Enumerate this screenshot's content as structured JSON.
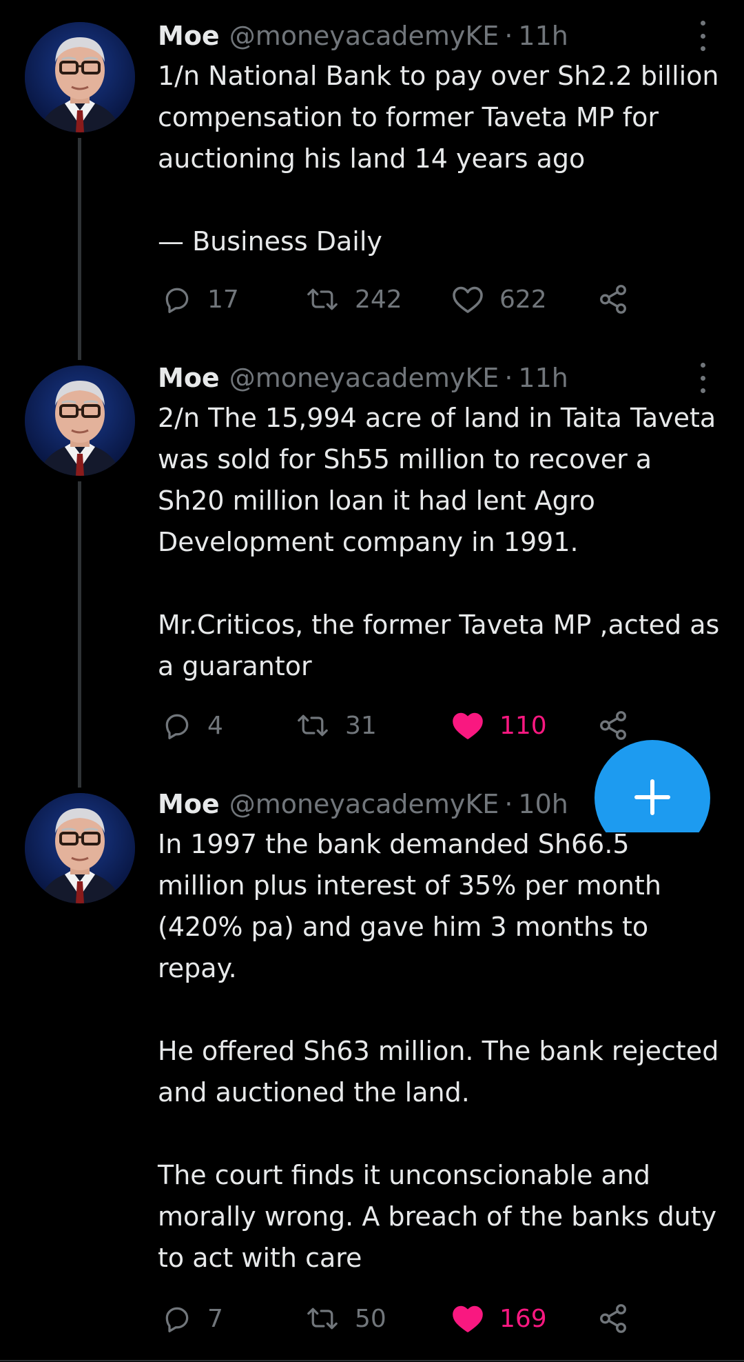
{
  "colors": {
    "background": "#000000",
    "text_primary": "#e7e9ea",
    "text_secondary": "#71767b",
    "like_active": "#f91880",
    "accent_blue": "#1d9bf0",
    "thread_line": "#2f3336"
  },
  "tweets": [
    {
      "author_name": "Moe",
      "handle": "@moneyacademyKE",
      "separator": "·",
      "time": "11h",
      "paragraphs": [
        "1/n National Bank to pay over Sh2.2 billion compensation to former Taveta MP for auctioning his land 14 years ago",
        "— Business Daily"
      ],
      "replies": "17",
      "retweets": "242",
      "likes": "622",
      "liked": false
    },
    {
      "author_name": "Moe",
      "handle": "@moneyacademyKE",
      "separator": "·",
      "time": "11h",
      "paragraphs": [
        "2/n The 15,994 acre of land in Taita Taveta was sold for Sh55 million to recover a Sh20 million loan it had lent Agro Development company in 1991.",
        "Mr.Criticos, the former Taveta MP ,acted as a guarantor"
      ],
      "replies": "4",
      "retweets": "31",
      "likes": "110",
      "liked": true
    },
    {
      "author_name": "Moe",
      "handle": "@moneyacademyKE",
      "separator": "·",
      "time": "10h",
      "paragraphs": [
        "In 1997 the bank demanded Sh66.5 million plus interest of 35% per month (420% pa) and gave him 3 months to repay.",
        "He offered Sh63 million. The bank rejected and auctioned the land.",
        "The court finds it unconscionable and morally wrong. A breach of the banks duty to act with care"
      ],
      "replies": "7",
      "retweets": "50",
      "likes": "169",
      "liked": true
    }
  ],
  "icons": {
    "reply": "reply-bubble-icon",
    "retweet": "retweet-arrows-icon",
    "like": "heart-icon",
    "share": "share-nodes-icon",
    "more": "vertical-dots-icon",
    "compose": "plus-icon"
  }
}
